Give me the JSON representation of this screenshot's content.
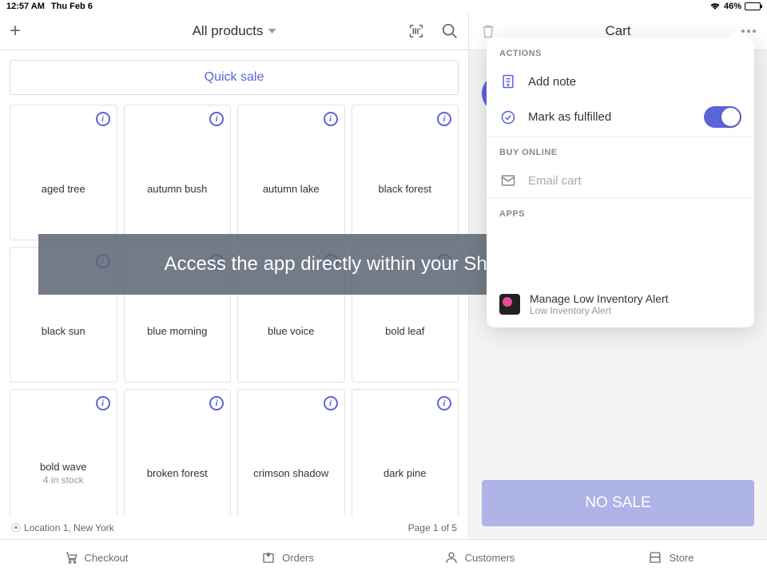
{
  "status": {
    "time": "12:57 AM",
    "date": "Thu Feb 6",
    "battery": "46%"
  },
  "header": {
    "title": "All products",
    "cart_title": "Cart"
  },
  "quick_sale": "Quick sale",
  "products": [
    {
      "name": "aged tree"
    },
    {
      "name": "autumn bush"
    },
    {
      "name": "autumn lake"
    },
    {
      "name": "black forest"
    },
    {
      "name": "black sun"
    },
    {
      "name": "blue morning"
    },
    {
      "name": "blue voice"
    },
    {
      "name": "bold leaf"
    },
    {
      "name": "bold wave",
      "stock": "4 in stock"
    },
    {
      "name": "broken forest"
    },
    {
      "name": "crimson shadow"
    },
    {
      "name": "dark pine"
    }
  ],
  "footer": {
    "location": "Location 1, New York",
    "page": "Page 1 of 5"
  },
  "overlay": "Access the app directly within your Shopify POS app",
  "popover": {
    "actions_label": "ACTIONS",
    "add_note": "Add note",
    "fulfilled": "Mark as fulfilled",
    "buy_online_label": "BUY ONLINE",
    "email_cart": "Email cart",
    "apps_label": "APPS",
    "app_title": "Manage Low Inventory Alert",
    "app_sub": "Low Inventory Alert"
  },
  "no_sale": "NO SALE",
  "nav": {
    "checkout": "Checkout",
    "orders": "Orders",
    "customers": "Customers",
    "store": "Store"
  }
}
